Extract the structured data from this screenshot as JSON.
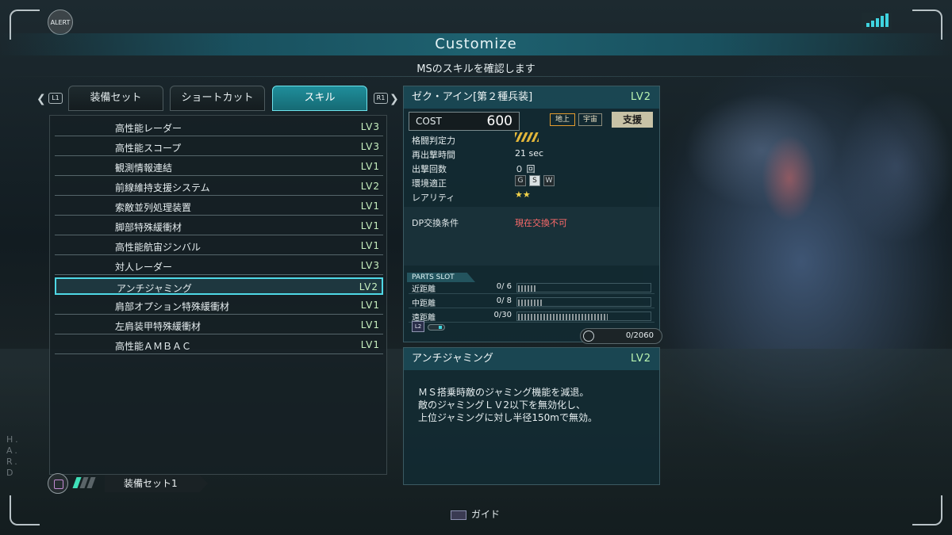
{
  "hud": {
    "alert_label": "ALERT",
    "side_text": "H.A.R.D"
  },
  "header": {
    "title": "Customize",
    "subtitle": "MSのスキルを確認します"
  },
  "tabs": {
    "left_button": "L1",
    "right_button": "R1",
    "items": [
      "装備セット",
      "ショートカット",
      "スキル"
    ],
    "active": "スキル"
  },
  "skills": [
    {
      "name": "高性能レーダー",
      "level": "LV3"
    },
    {
      "name": "高性能スコープ",
      "level": "LV3"
    },
    {
      "name": "観測情報連結",
      "level": "LV1"
    },
    {
      "name": "前線維持支援システム",
      "level": "LV2"
    },
    {
      "name": "索敵並列処理装置",
      "level": "LV1"
    },
    {
      "name": "脚部特殊緩衝材",
      "level": "LV1"
    },
    {
      "name": "高性能航宙ジンバル",
      "level": "LV1"
    },
    {
      "name": "対人レーダー",
      "level": "LV3"
    },
    {
      "name": "アンチジャミング",
      "level": "LV2"
    },
    {
      "name": "肩部オプション特殊緩衝材",
      "level": "LV1"
    },
    {
      "name": "左肩装甲特殊緩衝材",
      "level": "LV1"
    },
    {
      "name": "高性能ＡＭＢＡＣ",
      "level": "LV1"
    }
  ],
  "selected_skill_index": 8,
  "equip_set": {
    "label": "装備セット1"
  },
  "unit": {
    "name": "ゼク・アイン[第２種兵装]",
    "level": "LV2",
    "cost_label": "COST",
    "cost": "600",
    "terrain": [
      "地上",
      "宇宙"
    ],
    "role": "支援",
    "stats": [
      {
        "label": "格闘判定力",
        "value": ""
      },
      {
        "label": "再出撃時間",
        "value": "21 sec"
      },
      {
        "label": "出撃回数",
        "value": "０ 回"
      },
      {
        "label": "環境適正",
        "value": ""
      },
      {
        "label": "レアリティ",
        "value": "★★"
      }
    ],
    "environment": [
      "G",
      "S",
      "W"
    ],
    "dp_label": "DP交換条件",
    "dp_value": "現在交換不可"
  },
  "parts_slot": {
    "title": "PARTS SLOT",
    "rows": [
      {
        "label": "近距離",
        "count": "0/ 6",
        "fill": 0.14
      },
      {
        "label": "中距離",
        "count": "0/ 8",
        "fill": 0.18
      },
      {
        "label": "遠距離",
        "count": "0/30",
        "fill": 0.68
      }
    ],
    "l2_label": "L2",
    "weight": "0/2060"
  },
  "skill_detail": {
    "name": "アンチジャミング",
    "level": "LV2",
    "lines": [
      "ＭＳ搭乗時敵のジャミング機能を減退。",
      "敵のジャミングＬＶ2以下を無効化し、",
      "上位ジャミングに対し半径150mで無効。"
    ]
  },
  "footer": {
    "guide_label": "ガイド"
  },
  "colors": {
    "accent": "#4fd8e6",
    "level_text": "#c8f0c0",
    "warning": "#ff6b6b"
  }
}
